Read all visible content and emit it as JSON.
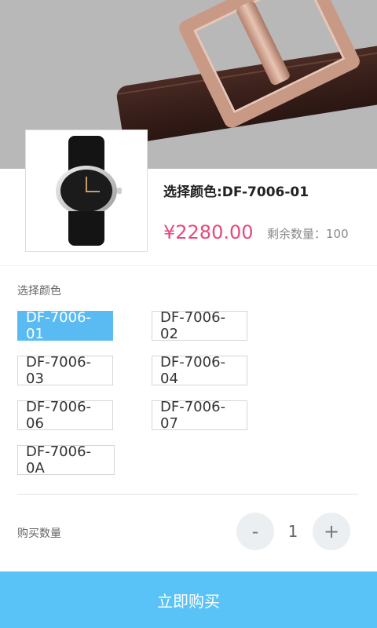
{
  "product": {
    "title": "选择颜色:DF-7006-01",
    "price": "¥2280.00",
    "stock": "剩余数量：100"
  },
  "colors": {
    "section_label": "选择颜色",
    "options": [
      {
        "label": "DF-7006-01"
      },
      {
        "label": "DF-7006-02"
      },
      {
        "label": "DF-7006-03"
      },
      {
        "label": "DF-7006-04"
      },
      {
        "label": "DF-7006-06"
      },
      {
        "label": "DF-7006-07"
      },
      {
        "label": "DF-7006-0A"
      }
    ],
    "selected": "DF-7006-01"
  },
  "quantity": {
    "label": "购买数量",
    "value": "1",
    "minus_label": "-",
    "plus_label": "+"
  },
  "actions": {
    "buy_label": "立即购买"
  },
  "theme": {
    "accent": "#59bbf2",
    "price_color": "#e6497a",
    "buy_bar": "#59c3f7"
  }
}
